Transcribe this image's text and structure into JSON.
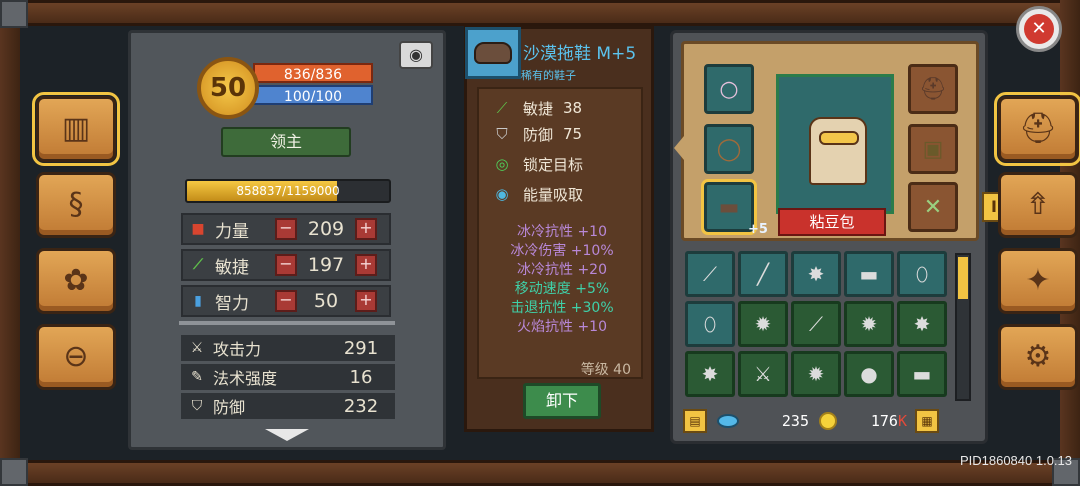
{
  "hero": {
    "level": "50",
    "hp": "836/836",
    "mp": "100/100",
    "title_label": "领主",
    "exp": "858837/1159000",
    "exp_progress": 0.741
  },
  "attributes": [
    {
      "label": "力量",
      "value": "209",
      "icon": "fist-icon",
      "color": "#d8452f"
    },
    {
      "label": "敏捷",
      "value": "197",
      "icon": "feather-icon",
      "color": "#5fc04a"
    },
    {
      "label": "智力",
      "value": "50",
      "icon": "book-icon",
      "color": "#4aa0e0"
    }
  ],
  "attr_controls": {
    "minus": "−",
    "plus": "+"
  },
  "combat_stats": [
    {
      "label": "攻击力",
      "value": "291",
      "icon": "sword-icon"
    },
    {
      "label": "法术强度",
      "value": "16",
      "icon": "wand-icon"
    },
    {
      "label": "防御",
      "value": "232",
      "icon": "shield-icon"
    }
  ],
  "item": {
    "name": "沙漠拖鞋 M+5",
    "subtitle": "稀有的鞋子",
    "stats": [
      {
        "label": "敏捷",
        "value": "38",
        "icon": "feather-icon"
      },
      {
        "label": "防御",
        "value": "75",
        "icon": "shield-icon"
      }
    ],
    "skills": [
      {
        "label": "锁定目标",
        "icon": "target-icon"
      },
      {
        "label": "能量吸取",
        "icon": "energy-icon"
      }
    ],
    "bonuses": [
      {
        "text": "冰冷抗性 +10",
        "color": "#b888d8"
      },
      {
        "text": "冰冷伤害 +10%",
        "color": "#b888d8"
      },
      {
        "text": "冰冷抗性 +20",
        "color": "#b888d8"
      },
      {
        "text": "移动速度 +5%",
        "color": "#3fd0a8"
      },
      {
        "text": "击退抗性 +30%",
        "color": "#3fd0a8"
      },
      {
        "text": "火焰抗性 +10",
        "color": "#b888d8"
      }
    ],
    "level_label": "等级 40",
    "unequip_label": "卸下"
  },
  "equipment": {
    "character_name": "粘豆包",
    "boots_plus": "+5",
    "side_tab": "I",
    "slots": [
      {
        "name": "ring-slot",
        "icon": "ring-icon"
      },
      {
        "name": "amulet-slot",
        "icon": "amulet-icon"
      },
      {
        "name": "boots-slot",
        "icon": "boots-icon"
      },
      {
        "name": "helmet-slot",
        "icon": "helmet-icon"
      },
      {
        "name": "armor-slot",
        "icon": "armor-icon"
      },
      {
        "name": "weapon-slot",
        "icon": "crossbow-icon"
      }
    ]
  },
  "inventory": [
    {
      "icon": "spear-icon",
      "style": "teal"
    },
    {
      "icon": "staff-icon",
      "style": "teal"
    },
    {
      "icon": "spiked-mace-icon",
      "style": "teal"
    },
    {
      "icon": "boots-icon",
      "style": "teal"
    },
    {
      "icon": "feather-icon",
      "style": "teal"
    },
    {
      "icon": "feather-icon",
      "style": "teal"
    },
    {
      "icon": "mace-icon",
      "style": "green"
    },
    {
      "icon": "spear-icon",
      "style": "green"
    },
    {
      "icon": "mace-icon",
      "style": "green"
    },
    {
      "icon": "spiked-mace-icon",
      "style": "green"
    },
    {
      "icon": "spiked-mace-icon",
      "style": "green"
    },
    {
      "icon": "crossed-swords-icon",
      "style": "green"
    },
    {
      "icon": "mace-icon",
      "style": "green"
    },
    {
      "icon": "round-shield-icon",
      "style": "green"
    },
    {
      "icon": "boots-icon",
      "style": "green"
    }
  ],
  "currency": {
    "gems": "235",
    "gold": "176",
    "gold_suffix": "K"
  },
  "side_nav_left": [
    {
      "name": "journal-button",
      "icon": "open-book-icon",
      "active": true
    },
    {
      "name": "crafting-button",
      "icon": "scroll-icon",
      "active": false
    },
    {
      "name": "pets-button",
      "icon": "paw-icon",
      "active": false
    },
    {
      "name": "vehicle-button",
      "icon": "steering-wheel-icon",
      "active": false
    }
  ],
  "side_nav_right": [
    {
      "name": "hero-button",
      "icon": "helmet-icon",
      "active": true
    },
    {
      "name": "skills-button",
      "icon": "upgrade-icon",
      "active": false
    },
    {
      "name": "talents-button",
      "icon": "compass-star-icon",
      "active": false
    },
    {
      "name": "settings-button",
      "icon": "gear-icon",
      "active": false
    }
  ],
  "version": "PID1860840 1.0.13"
}
